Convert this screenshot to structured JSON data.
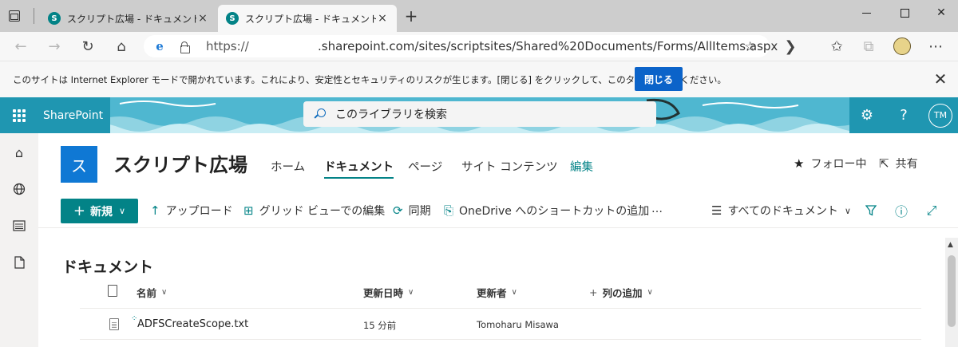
{
  "browser": {
    "tabs": [
      {
        "title": "スクリプト広場 - ドキュメント - すべて",
        "favicon": "S",
        "active": false
      },
      {
        "title": "スクリプト広場 - ドキュメント - すべて",
        "favicon": "S",
        "active": true
      }
    ],
    "new_tab": "+",
    "window_controls": {
      "close": "✕"
    },
    "address": {
      "protocol": "https://",
      "rest": ".sharepoint.com/sites/scriptsites/Shared%20Documents/Forms/AllItems.aspx"
    }
  },
  "ie_bar": {
    "message": "このサイトは Internet Explorer モードで開かれています。これにより、安定性とセキュリティのリスクが生じます。[閉じる] をクリックして、このタブを閉じてください。",
    "close_button": "閉じる",
    "dismiss": "✕"
  },
  "suite": {
    "brand": "SharePoint",
    "search_placeholder": "このライブラリを検索",
    "help": "?",
    "avatar_initials": "TM",
    "accent": "#038387"
  },
  "site": {
    "logo_letter": "ス",
    "title": "スクリプト広場",
    "nav": [
      "ホーム",
      "ドキュメント",
      "ページ",
      "サイト コンテンツ",
      "編集"
    ],
    "follow": "フォロー中",
    "share": "共有"
  },
  "commands": {
    "new": "新規",
    "upload": "アップロード",
    "grid_edit": "グリッド ビューでの編集",
    "sync": "同期",
    "onedrive_shortcut": "OneDrive へのショートカットの追加",
    "more": "…",
    "view": "すべてのドキュメント"
  },
  "library": {
    "title": "ドキュメント",
    "columns": {
      "name": "名前",
      "modified": "更新日時",
      "modified_by": "更新者",
      "add_column": "列の追加"
    },
    "rows": [
      {
        "name": "ADFSCreateScope.txt",
        "modified": "15 分前",
        "modified_by": "Tomoharu Misawa"
      }
    ]
  }
}
